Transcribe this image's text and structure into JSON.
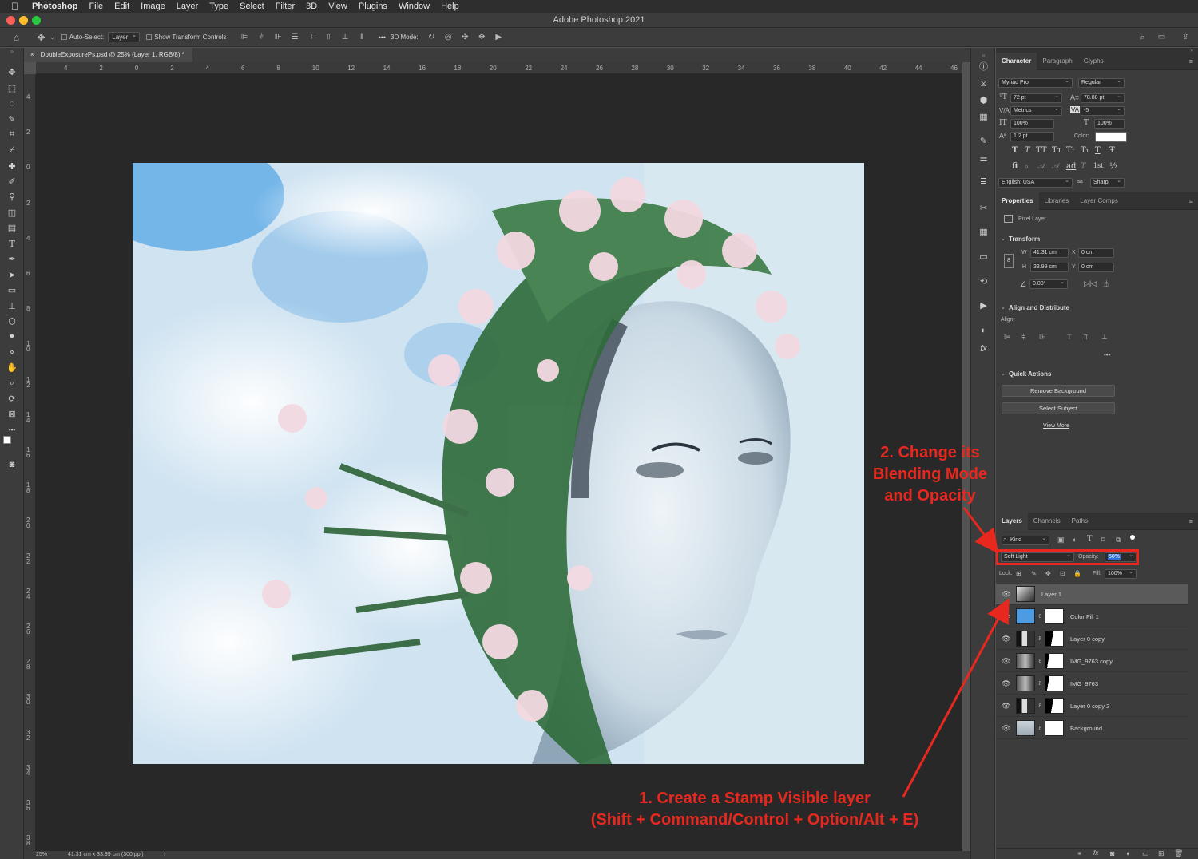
{
  "menubar": {
    "items": [
      "Photoshop",
      "File",
      "Edit",
      "Image",
      "Layer",
      "Type",
      "Select",
      "Filter",
      "3D",
      "View",
      "Plugins",
      "Window",
      "Help"
    ]
  },
  "window": {
    "title": "Adobe Photoshop 2021"
  },
  "options": {
    "auto_select_label": "Auto-Select:",
    "auto_select_value": "Layer",
    "transform_label": "Show Transform Controls",
    "mode3d_label": "3D Mode:",
    "more": "•••"
  },
  "document": {
    "tab_label": "DoubleExposurePs.psd @ 25% (Layer 1, RGB/8) *",
    "tab_close": "×",
    "zoom": "25%",
    "dimensions": "41.31 cm x 33.99 cm (300 ppi)",
    "status_arrow": "›"
  },
  "rulers": {
    "h": [
      "4",
      "2",
      "0",
      "2",
      "4",
      "6",
      "8",
      "10",
      "12",
      "14",
      "16",
      "18",
      "20",
      "22",
      "24",
      "26",
      "28",
      "30",
      "32",
      "34",
      "36",
      "38",
      "40",
      "42",
      "44",
      "46"
    ],
    "v": [
      "4",
      "2",
      "0",
      "2",
      "4",
      "6",
      "8",
      "10",
      "12",
      "14",
      "16",
      "18",
      "20",
      "22",
      "24",
      "26",
      "28",
      "30",
      "32",
      "34",
      "36",
      "38"
    ]
  },
  "character": {
    "tabs": [
      "Character",
      "Paragraph",
      "Glyphs"
    ],
    "font": "Myriad Pro",
    "style": "Regular",
    "size": "72 pt",
    "leading": "78.88 pt",
    "kerning": "Metrics",
    "tracking": "-5",
    "vscale": "100%",
    "hscale": "100%",
    "baseline": "1.2 pt",
    "color_label": "Color:",
    "language": "English: USA",
    "aa_label": "aa",
    "antialias": "Sharp",
    "glyphs_row1": [
      "T",
      "T",
      "TT",
      "Tт",
      "T¹",
      "T₁",
      "T",
      "Ŧ"
    ],
    "glyphs_row2": [
      "fi",
      "ℴ",
      "𝒜",
      "𝒜",
      "ad",
      "T",
      "1st",
      "½"
    ]
  },
  "properties": {
    "tabs": [
      "Properties",
      "Libraries",
      "Layer Comps"
    ],
    "kind": "Pixel Layer",
    "transform_header": "Transform",
    "w_label": "W",
    "w": "41.31 cm",
    "x_label": "X",
    "x": "0 cm",
    "h_label": "H",
    "h": "33.99 cm",
    "y_label": "Y",
    "y": "0 cm",
    "angle": "0.00°",
    "align_header": "Align and Distribute",
    "align_label": "Align:",
    "more": "•••",
    "quick_header": "Quick Actions",
    "btn_remove_bg": "Remove Background",
    "btn_select_subject": "Select Subject",
    "view_more": "View More"
  },
  "layers_panel": {
    "tabs": [
      "Layers",
      "Channels",
      "Paths"
    ],
    "filter_kind": "Kind",
    "blend_mode": "Soft Light",
    "opacity_label": "Opacity:",
    "opacity": "50%",
    "lock_label": "Lock:",
    "fill_label": "Fill:",
    "fill": "100%",
    "layers": [
      {
        "name": "Layer 1",
        "selected": true,
        "mask": false
      },
      {
        "name": "Color Fill 1",
        "selected": false,
        "mask": true
      },
      {
        "name": "Layer 0 copy",
        "selected": false,
        "mask": true
      },
      {
        "name": "IMG_9763 copy",
        "selected": false,
        "mask": true
      },
      {
        "name": "IMG_9763",
        "selected": false,
        "mask": true
      },
      {
        "name": "Layer 0 copy 2",
        "selected": false,
        "mask": true
      },
      {
        "name": "Background",
        "selected": false,
        "mask": true
      }
    ],
    "footer_icons": [
      "link-icon",
      "fx-icon",
      "mask-icon",
      "adjustment-icon",
      "folder-icon",
      "new-layer-icon",
      "trash-icon"
    ]
  },
  "annotations": {
    "step2_line1": "2. Change its",
    "step2_line2": "Blending Mode",
    "step2_line3": "and Opacity",
    "step1_line1": "1. Create a Stamp Visible layer",
    "step1_line2": "(Shift + Command/Control + Option/Alt + E)"
  },
  "colors": {
    "annotation_red": "#e8281f",
    "panel_bg": "#3c3c3c",
    "canvas_bg": "#282828",
    "color_fill_blue": "#4d9be0",
    "text_color_swatch": "#ffffff"
  }
}
